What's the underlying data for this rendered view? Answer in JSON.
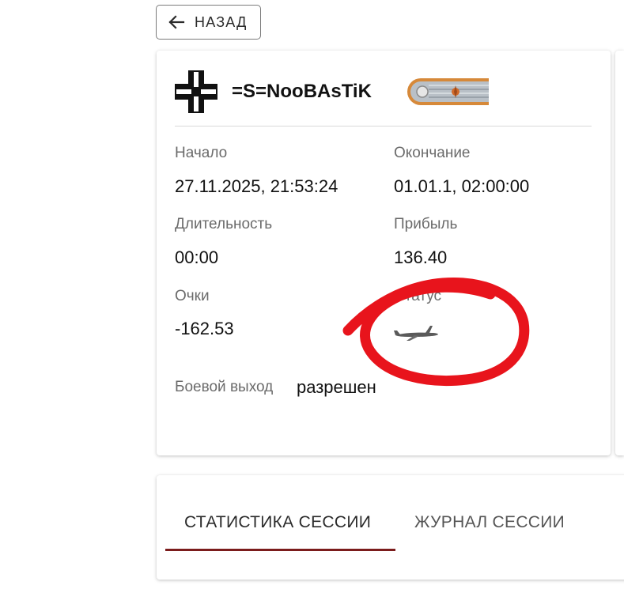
{
  "back_button": {
    "label": "НАЗАД",
    "icon": "arrow-left-icon"
  },
  "player": {
    "nickname": "=S=NooBAsTiK",
    "faction_icon": "balkenkreuz-icon",
    "rank_icon": "rank-epaulette-icon"
  },
  "session": {
    "start_label": "Начало",
    "start_value": "27.11.2025, 21:53:24",
    "end_label": "Окончание",
    "end_value": "01.01.1, 02:00:00",
    "duration_label": "Длительность",
    "duration_value": "00:00",
    "profit_label": "Прибыль",
    "profit_value": "136.40",
    "score_label": "Очки",
    "score_value": "-162.53",
    "status_label": "Статус",
    "status_icon": "aircraft-icon",
    "combat_label": "Боевой выход",
    "combat_value": "разрешен"
  },
  "tabs": [
    {
      "label": "СТАТИСТИКА СЕССИИ",
      "active": true
    },
    {
      "label": "ЖУРНАЛ СЕССИИ",
      "active": false
    }
  ],
  "colors": {
    "tab_indicator": "#7b1c1c",
    "annotation": "#e8141c"
  }
}
